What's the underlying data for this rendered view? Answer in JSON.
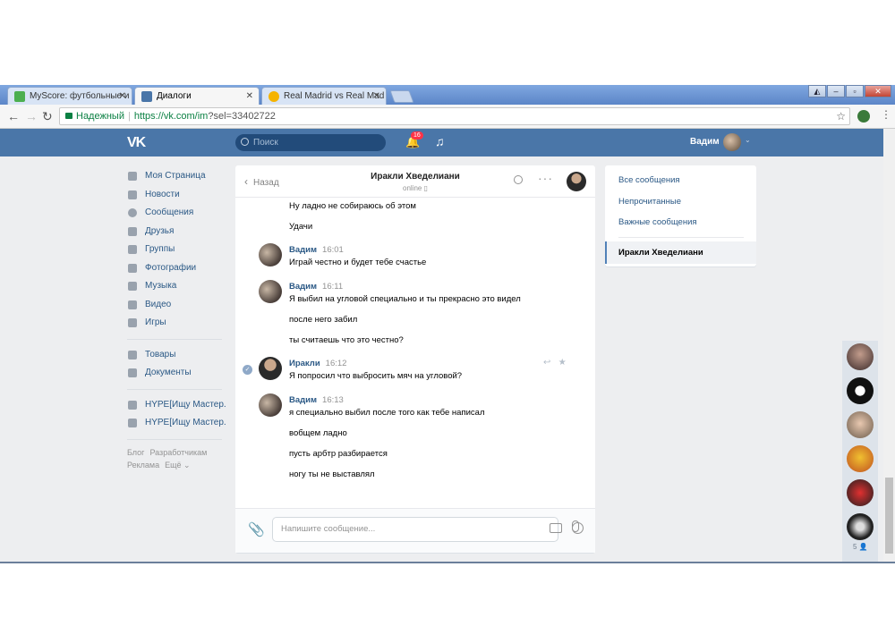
{
  "browser": {
    "tabs": [
      {
        "title": "MyScore: футбольные и",
        "active": false
      },
      {
        "title": "Диалоги",
        "active": true
      },
      {
        "title": "Real Madrid vs Real Mad",
        "active": false
      }
    ],
    "address": {
      "secure_label": "Надежный",
      "url_host": "https://vk.com/im",
      "url_query": "?sel=33402722"
    }
  },
  "header": {
    "logo": "VK",
    "search_placeholder": "Поиск",
    "notifications_count": "16",
    "user_name": "Вадим"
  },
  "leftnav": {
    "items": [
      {
        "label": "Моя Страница"
      },
      {
        "label": "Новости"
      },
      {
        "label": "Сообщения"
      },
      {
        "label": "Друзья"
      },
      {
        "label": "Группы"
      },
      {
        "label": "Фотографии"
      },
      {
        "label": "Музыка"
      },
      {
        "label": "Видео"
      },
      {
        "label": "Игры"
      }
    ],
    "items2": [
      {
        "label": "Товары"
      },
      {
        "label": "Документы"
      }
    ],
    "items3": [
      {
        "label": "HYPE[Ищу Мастер.."
      },
      {
        "label": "HYPE[Ищу Мастер.."
      }
    ],
    "footer": {
      "blog": "Блог",
      "dev": "Разработчикам",
      "ads": "Реклама",
      "more": "Ещё ⌄"
    }
  },
  "dialog": {
    "back_label": "Назад",
    "name": "Иракли Хведелиани",
    "status": "online",
    "messages": {
      "m0": "Ну ладно не собираюсь об этом",
      "m1": "Удачи",
      "g1_author": "Вадим",
      "g1_time": "16:01",
      "m2": "Играй честно и будет тебе счастье",
      "g2_author": "Вадим",
      "g2_time": "16:11",
      "m3": "Я выбил на угловой специально и ты прекрасно это видел",
      "m4": "после него забил",
      "m5": "ты считаешь что это честно?",
      "g3_author": "Иракли",
      "g3_time": "16:12",
      "m6": "Я попросил что выбросить мяч на угловой?",
      "g4_author": "Вадим",
      "g4_time": "16:13",
      "m7": "я специально выбил после того как тебе написал",
      "m8": "вобщем ладно",
      "m9": "пусть арбтр разбирается",
      "m10": "ногу ты не выставлял"
    },
    "composer_placeholder": "Напишите сообщение..."
  },
  "rightpanel": {
    "all": "Все сообщения",
    "unread": "Непрочитанные",
    "important": "Важные сообщения",
    "selected": "Иракли Хведелиани"
  },
  "chatbar": {
    "count": "5"
  }
}
